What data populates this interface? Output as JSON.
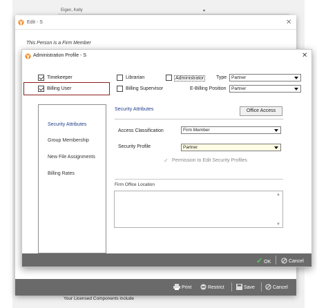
{
  "background": {
    "row_text": "Eigen, Kelly",
    "row_dropdown": "▾"
  },
  "edit_window": {
    "title": "Edit - S",
    "notice": "This Person is a Firm Member",
    "footer": {
      "print": "Print",
      "restrict": "Restrict",
      "save": "Save",
      "cancel": "Cancel"
    }
  },
  "licensed_text": "Your Licensed Components include",
  "admin_dialog": {
    "title": "Administration Profile - S",
    "checkboxes": {
      "timekeeper": {
        "label": "Timekeeper",
        "checked": true
      },
      "billing_user": {
        "label": "Billing User",
        "checked": true
      },
      "librarian": {
        "label": "Librarian",
        "checked": false
      },
      "administrator": {
        "label": "Administrator",
        "checked": false
      },
      "billing_supervisor": {
        "label": "Billing Supervisor",
        "checked": false
      }
    },
    "type": {
      "label": "Type",
      "value": "Partner"
    },
    "ebilling_position": {
      "label": "E-Billing Position",
      "value": "Partner"
    },
    "nav": [
      "Security Attributes",
      "Group Membership",
      "New File Assignments",
      "Billing Rates"
    ],
    "security": {
      "heading": "Security Attributes",
      "office_access_button": "Office Access",
      "access_classification": {
        "label": "Access Classification",
        "value": "Firm Member"
      },
      "security_profile": {
        "label": "Security Profile",
        "value": "Partner"
      },
      "permission_edit": {
        "label": "Permission to Edit Security Profiles",
        "checked": true
      },
      "firm_office_location_label": "Firm Office Location"
    },
    "footer": {
      "ok": "OK",
      "cancel": "Cancel"
    }
  },
  "colors": {
    "accent_blue": "#1f3f8c",
    "footer_gray": "#6a6a6a",
    "ok_green": "#5cc85c",
    "highlight_red": "#8b1b1b",
    "icon_orange": "#f0881e"
  }
}
